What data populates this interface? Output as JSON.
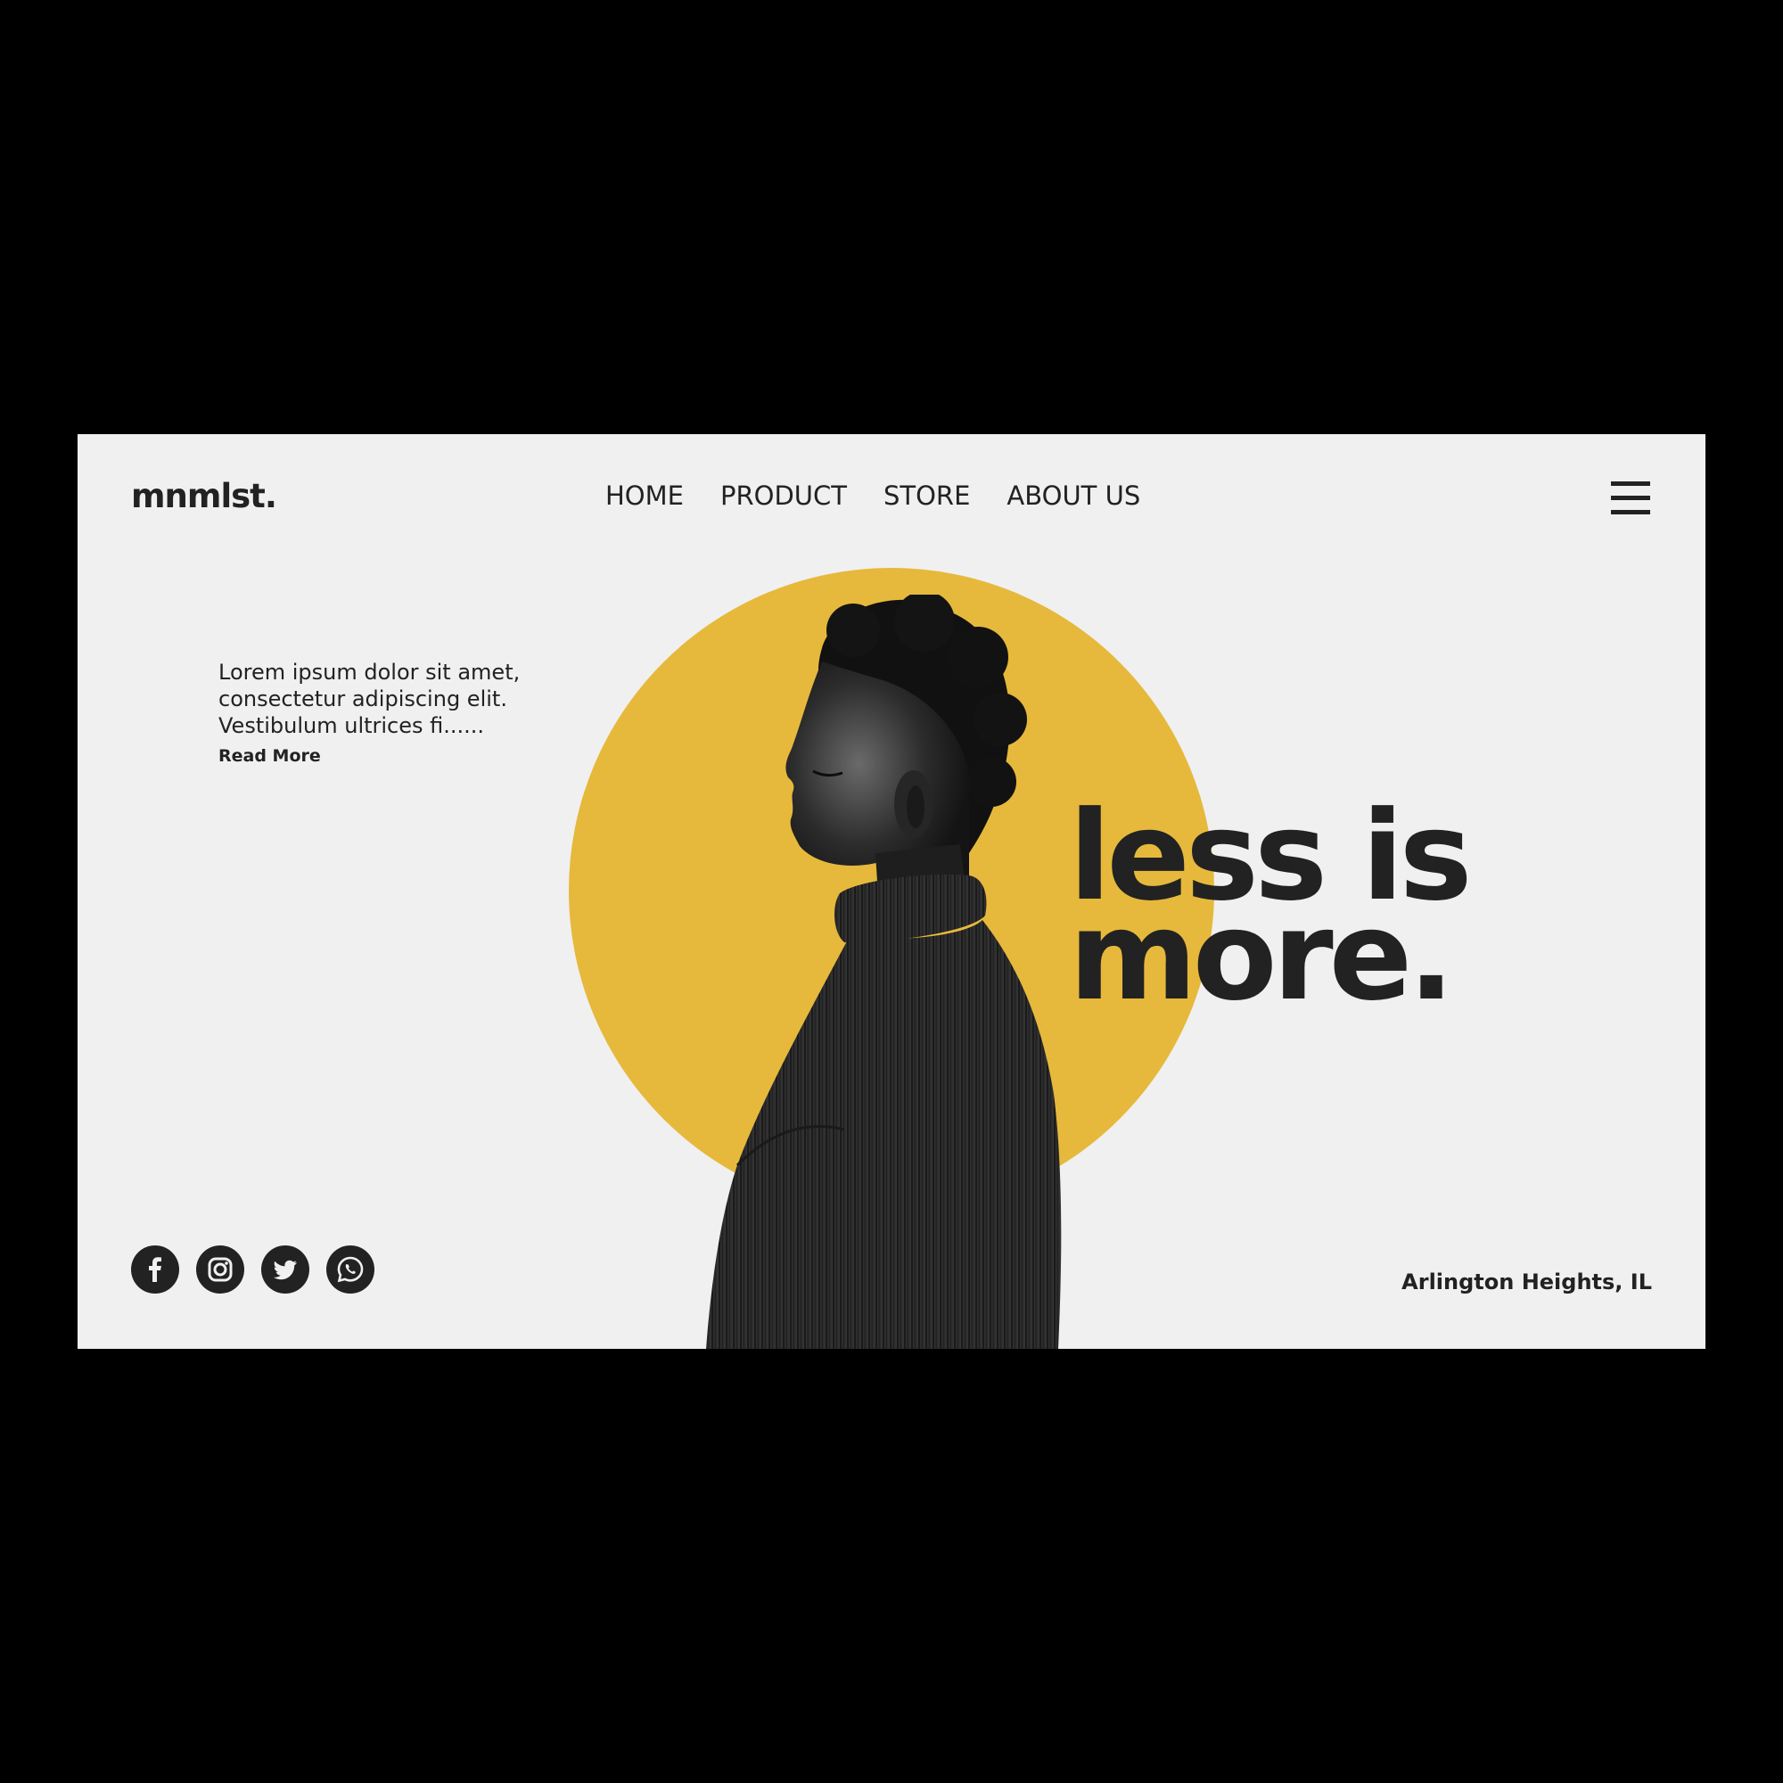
{
  "brand": {
    "logo": "mnmlst."
  },
  "nav": {
    "items": [
      {
        "label": "HOME"
      },
      {
        "label": "PRODUCT"
      },
      {
        "label": "STORE"
      },
      {
        "label": "ABOUT US"
      }
    ],
    "menu_icon": "hamburger-menu-icon"
  },
  "intro": {
    "text": "Lorem ipsum dolor sit amet, consectetur adipiscing elit. Vestibulum ultrices fi......",
    "read_more": "Read More"
  },
  "hero": {
    "headline_line1": "less is",
    "headline_line2": "more.",
    "image": "portrait-man-profile-black-turtleneck"
  },
  "social": [
    {
      "icon": "facebook-icon"
    },
    {
      "icon": "instagram-icon"
    },
    {
      "icon": "twitter-icon"
    },
    {
      "icon": "whatsapp-icon"
    }
  ],
  "footer": {
    "location": "Arlington Heights, IL"
  },
  "colors": {
    "background": "#f0f0f0",
    "accent": "#e6b93c",
    "text": "#222222",
    "frame": "#000000"
  }
}
